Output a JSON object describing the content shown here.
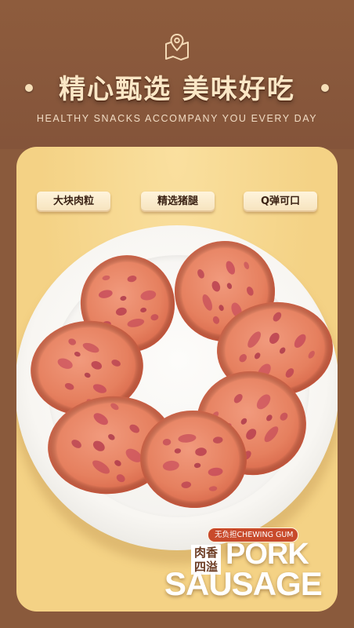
{
  "header": {
    "icon": "map-location-icon",
    "title": "精心甄选 美味好吃",
    "subtitle": "HEALTHY SNACKS ACCOMPANY YOU EVERY DAY"
  },
  "tags": [
    "大块肉粒",
    "精选猪腿",
    "Q弹可口"
  ],
  "product": {
    "tagline": "无负担CHEWING GUM",
    "badge_line1": "肉香",
    "badge_line2": "四溢",
    "name_line1": "PORK",
    "name_line2": "SAUSAGE"
  },
  "colors": {
    "background": "#8a5a3c",
    "panel": "#f4d285",
    "title": "#fbe7c6",
    "sausage": "#e9866b",
    "tagline_bg": "#c84a2b"
  }
}
